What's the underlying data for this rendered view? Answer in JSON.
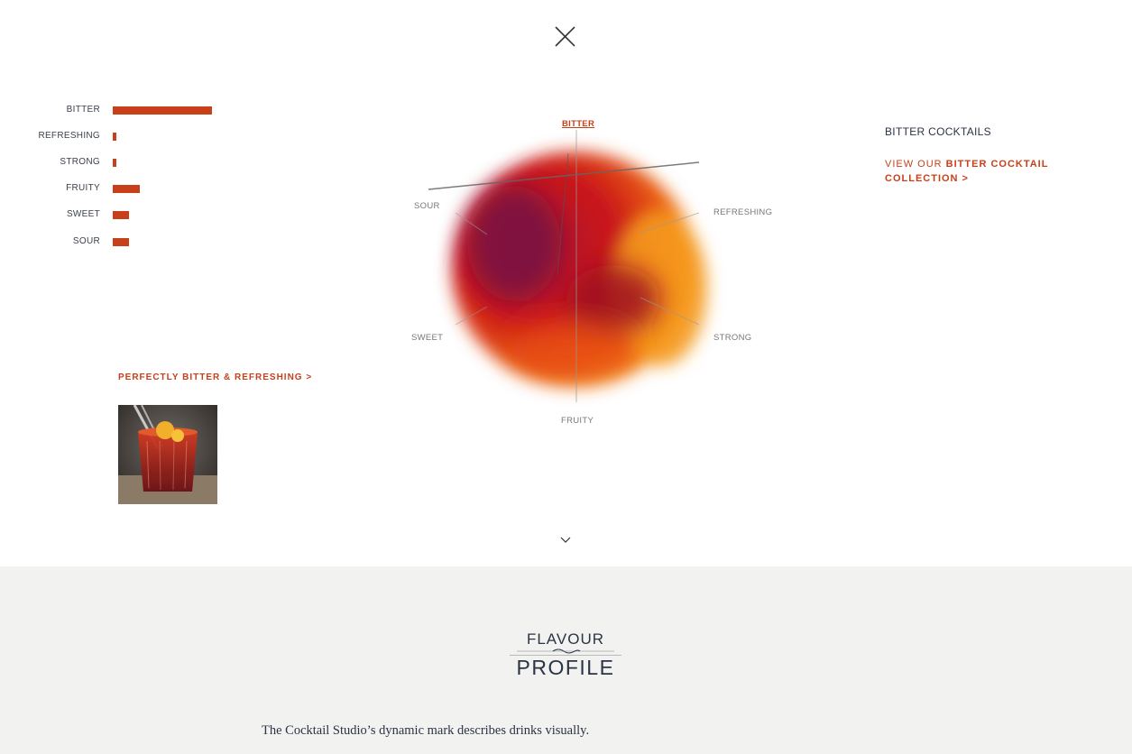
{
  "close": {
    "icon": "close-icon"
  },
  "profile": {
    "title": "BITTER COCKTAILS",
    "link_prefix": "VIEW OUR ",
    "link_bold": "BITTER COCKTAIL COLLECTION >",
    "bars": [
      {
        "label": "BITTER",
        "value": 1.0
      },
      {
        "label": "REFRESHING",
        "value": 0.04
      },
      {
        "label": "STRONG",
        "value": 0.04
      },
      {
        "label": "FRUITY",
        "value": 0.27
      },
      {
        "label": "SWEET",
        "value": 0.16
      },
      {
        "label": "SOUR",
        "value": 0.16
      }
    ],
    "feature_link": "PERFECTLY BITTER & REFRESHING >",
    "accent_color": "#c8401a"
  },
  "mark": {
    "labels": {
      "bitter": "BITTER",
      "refreshing": "REFRESHING",
      "strong": "STRONG",
      "fruity": "FRUITY",
      "sweet": "SWEET",
      "sour": "SOUR"
    }
  },
  "more": {
    "icon": "chevron-down-icon"
  },
  "intro": {
    "logo_top": "FLAVOUR",
    "logo_bottom": "PROFILE",
    "text": "The Cocktail Studio’s dynamic mark describes drinks visually."
  }
}
